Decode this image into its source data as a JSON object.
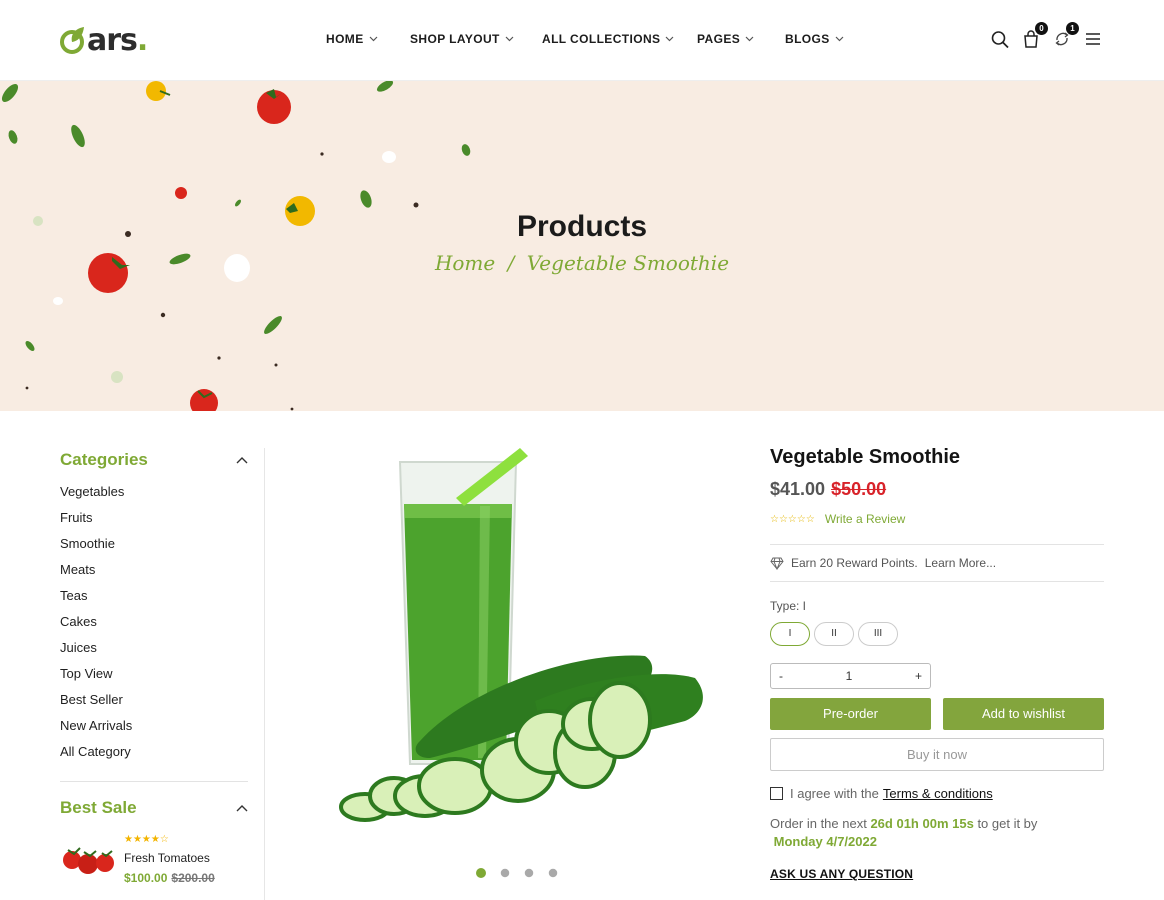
{
  "header": {
    "logo": {
      "text": "ars",
      "dot": "."
    },
    "nav": [
      {
        "label": "HOME"
      },
      {
        "label": "SHOP LAYOUT"
      },
      {
        "label": "ALL COLLECTIONS"
      },
      {
        "label": "PAGES"
      },
      {
        "label": "BLOGS"
      }
    ],
    "icons": [
      "search-icon",
      "cart-icon",
      "compare-icon",
      "menu-icon"
    ],
    "cart_count": "0",
    "compare_count": "1"
  },
  "banner": {
    "title": "Products",
    "breadcrumb": {
      "home": "Home",
      "separator": "/",
      "current": "Vegetable Smoothie"
    }
  },
  "sidebar": {
    "categories_title": "Categories",
    "categories": [
      "Vegetables",
      "Fruits",
      "Smoothie",
      "Meats",
      "Teas",
      "Cakes",
      "Juices",
      "Top View",
      "Best Seller",
      "New Arrivals",
      "All Category"
    ],
    "best_sale_title": "Best Sale",
    "best_sale_item": {
      "name": "Fresh Tomatoes",
      "price": "$100.00",
      "old_price": "$200.00",
      "stars": "★★★★☆",
      "rating": 4
    }
  },
  "product": {
    "title": "Vegetable Smoothie",
    "price": "$41.00",
    "old_price": "$50.00",
    "stars": "☆☆☆☆☆",
    "review_link": "Write a Review",
    "reward": "Earn 20 Reward Points.",
    "learn_more": "Learn More...",
    "type_label": "Type: I",
    "types": [
      "I",
      "II",
      "III"
    ],
    "selected_type": "I",
    "qty_minus": "-",
    "qty_value": "1",
    "qty_plus": "+",
    "preorder": "Pre-order",
    "wishlist": "Add to wishlist",
    "buy_now": "Buy it now",
    "agree_text": "I agree with the",
    "terms": "Terms & conditions",
    "order_prefix": "Order in the next",
    "countdown": "26d 01h 00m 15s",
    "order_mid": "to get it by",
    "delivery_date": "Monday 4/7/2022",
    "ask": "ASK US ANY QUESTION",
    "image_dots": 4,
    "active_dot": 1
  },
  "colors": {
    "accent": "#7fa935",
    "sale_red": "#d8232a",
    "banner_bg": "#f8ece2"
  }
}
